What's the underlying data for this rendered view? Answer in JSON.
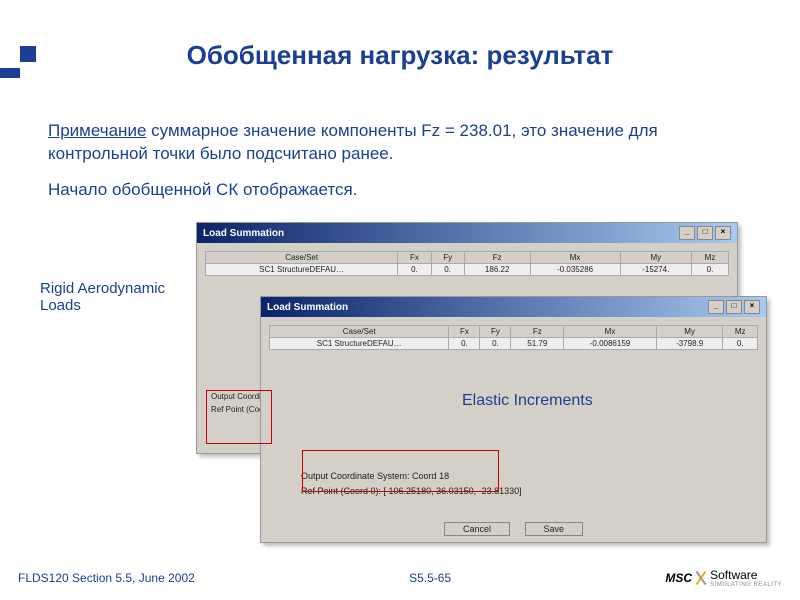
{
  "title": "Обобщенная нагрузка: результат",
  "note_label": "Примечание",
  "para1_rest": " суммарное значение компоненты Fz = 238.01, это значение для контрольной точки было подсчитано ранее.",
  "para2": "Начало обобщенной СК отображается.",
  "label_left": "Rigid Aerodynamic Loads",
  "label_mid": "Elastic Increments",
  "dialog": {
    "title": "Load Summation",
    "headers": [
      "Case/Set",
      "Fx",
      "Fy",
      "Fz",
      "Mx",
      "My",
      "Mz"
    ],
    "row1": [
      "SC1 StructureDEFAU…",
      "0.",
      "0.",
      "186.22",
      "-0.035286",
      "-15274.",
      "0."
    ],
    "row2": [
      "SC1 StructureDEFAU…",
      "0.",
      "0.",
      "51.79",
      "-0.0086159",
      "-3798.9",
      "0."
    ],
    "output_line1_d1": "Output Coordi…",
    "output_line2_d1": "Ref Point (Coo…",
    "output_line1": "Output Coordinate System: Coord 18",
    "output_line2": "Ref Point (Coord 0):   [ 106.25180,   36.03150,  -23.81330]",
    "btn_cancel": "Cancel",
    "btn_save": "Save"
  },
  "footer": {
    "left": "FLDS120 Section 5.5, June 2002",
    "center": "S5.5-65",
    "logo1": "MSC",
    "logo2": "Software",
    "logo_tag": "SIMULATING REALITY"
  }
}
